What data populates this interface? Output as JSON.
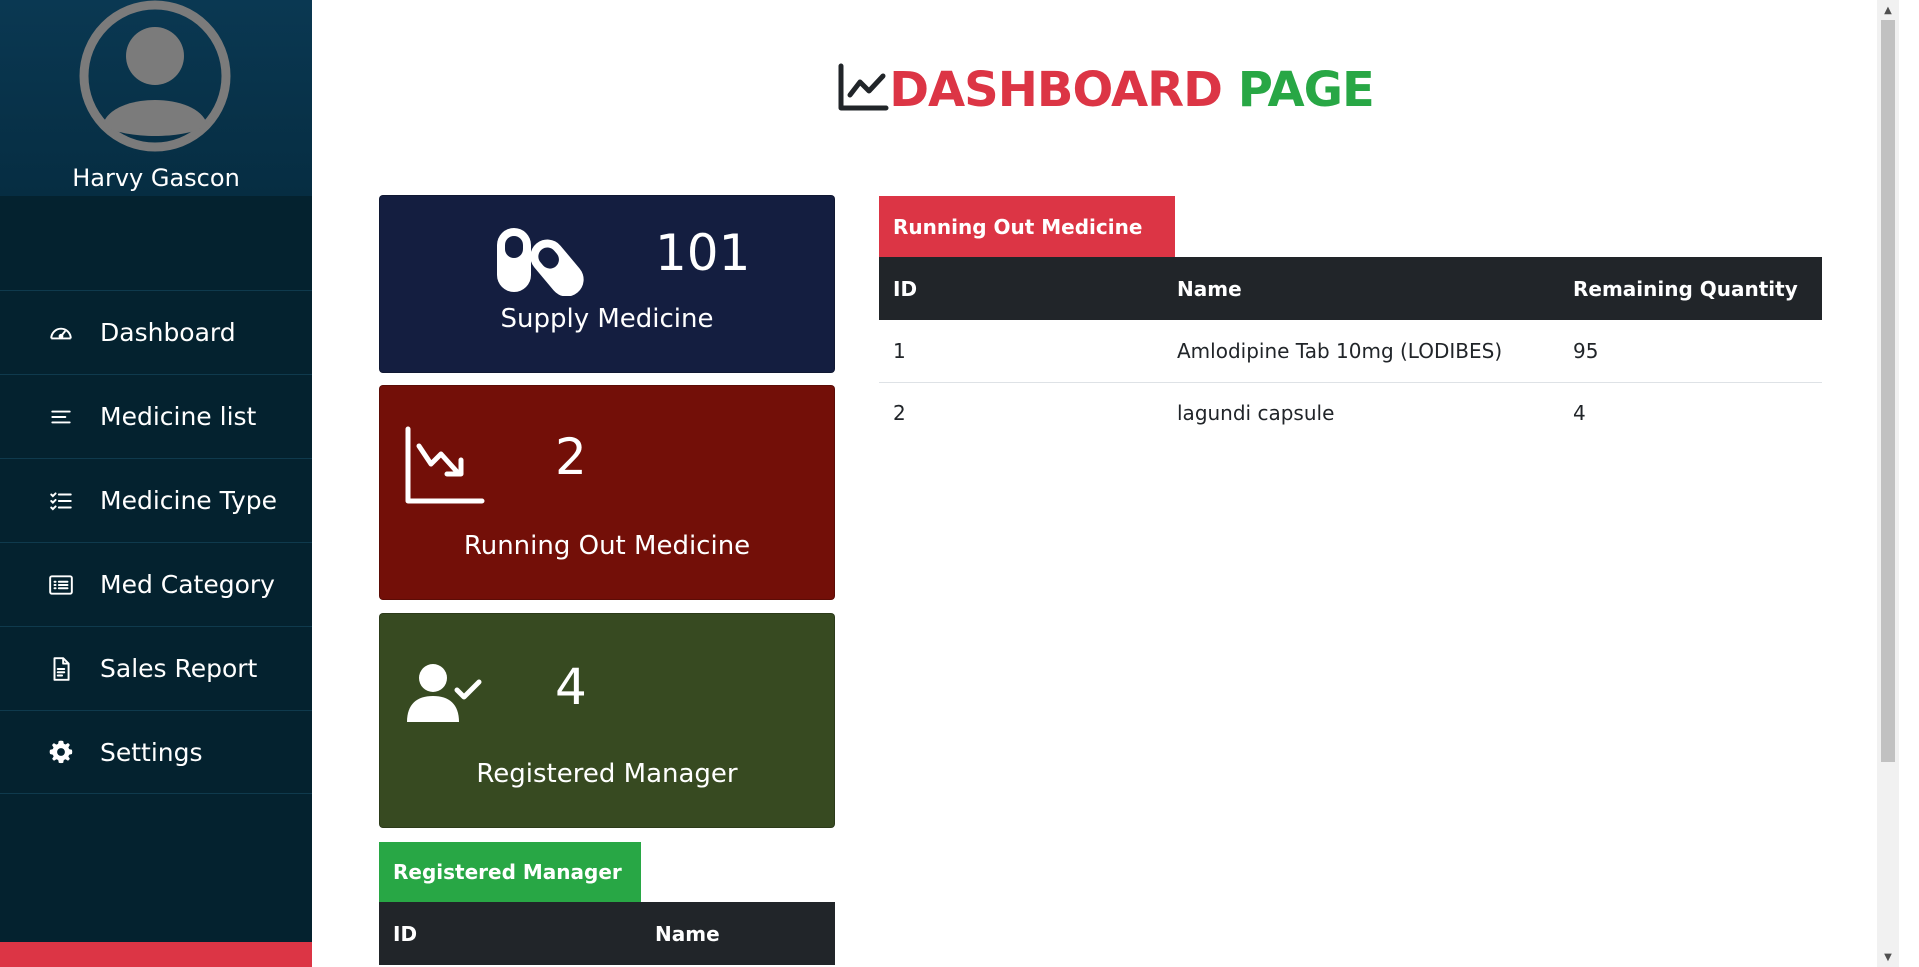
{
  "sidebar": {
    "profile_name": "Harvy Gascon",
    "avatar_icon": "user-circle-icon",
    "items": [
      {
        "label": "Dashboard",
        "icon": "speedometer-icon"
      },
      {
        "label": "Medicine list",
        "icon": "align-left-icon"
      },
      {
        "label": "Medicine Type",
        "icon": "checklist-icon"
      },
      {
        "label": "Med Category",
        "icon": "list-box-icon"
      },
      {
        "label": "Sales Report",
        "icon": "document-icon"
      },
      {
        "label": "Settings",
        "icon": "gear-icon"
      }
    ],
    "footer_color": "#dc3545"
  },
  "header": {
    "title_part1": "DASHBOARD",
    "title_part2": "PAGE",
    "title_icon": "line-chart-icon",
    "colors": {
      "part1": "#dc3545",
      "part2": "#28a745"
    }
  },
  "cards": {
    "supply": {
      "value": "101",
      "label": "Supply Medicine",
      "icon": "capsules-icon",
      "color": "#141e40"
    },
    "running": {
      "value": "2",
      "label": "Running Out Medicine",
      "icon": "chart-down-icon",
      "color": "#730f08"
    },
    "managers": {
      "value": "4",
      "label": "Registered Manager",
      "icon": "user-check-icon",
      "color": "#374a21"
    }
  },
  "running_out": {
    "tab_label": "Running Out Medicine",
    "columns": [
      "ID",
      "Name",
      "Remaining Quantity"
    ],
    "rows": [
      [
        "1",
        "Amlodipine Tab 10mg (LODIBES)",
        "95"
      ],
      [
        "2",
        "lagundi capsule",
        "4"
      ]
    ]
  },
  "registered_managers": {
    "tab_label": "Registered Manager",
    "columns": [
      "ID",
      "Name"
    ]
  }
}
